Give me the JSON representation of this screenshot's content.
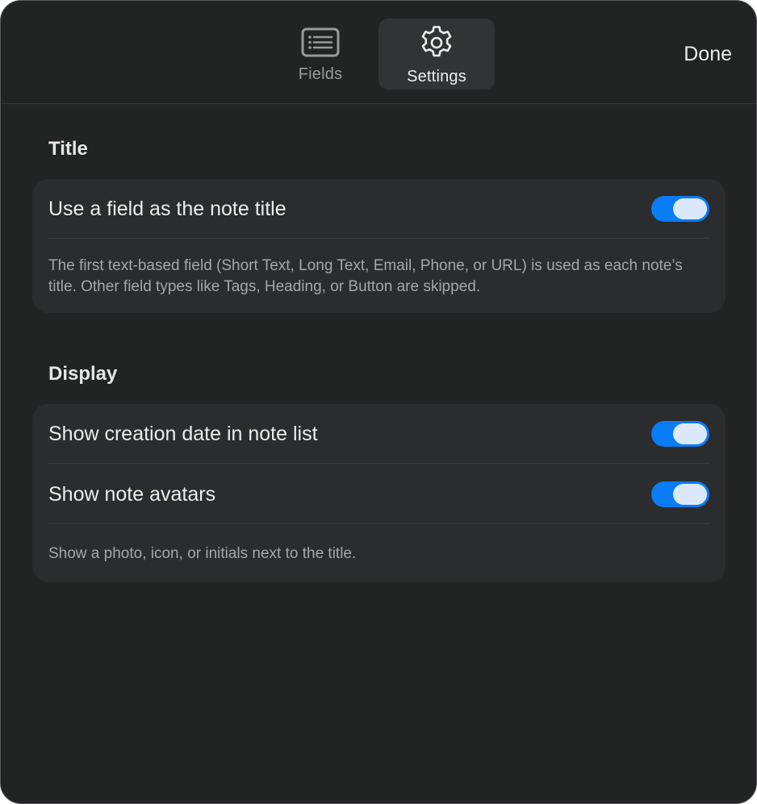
{
  "header": {
    "tabs": [
      {
        "label": "Fields",
        "icon": "list-icon",
        "selected": false
      },
      {
        "label": "Settings",
        "icon": "gear-icon",
        "selected": true
      }
    ],
    "done_label": "Done"
  },
  "sections": {
    "title": {
      "heading": "Title",
      "rows": [
        {
          "label": "Use a field as the note title",
          "enabled": true
        }
      ],
      "description": "The first text-based field (Short Text, Long Text, Email, Phone, or URL) is used as each note’s title. Other field types like Tags, Heading, or Button are skipped."
    },
    "display": {
      "heading": "Display",
      "rows": [
        {
          "label": "Show creation date in note list",
          "enabled": true
        },
        {
          "label": "Show note avatars",
          "enabled": true
        }
      ],
      "description": "Show a photo, icon, or initials next to the title."
    }
  },
  "colors": {
    "accent": "#0a7cf5",
    "background": "#222323",
    "card": "#2b2c2d"
  }
}
